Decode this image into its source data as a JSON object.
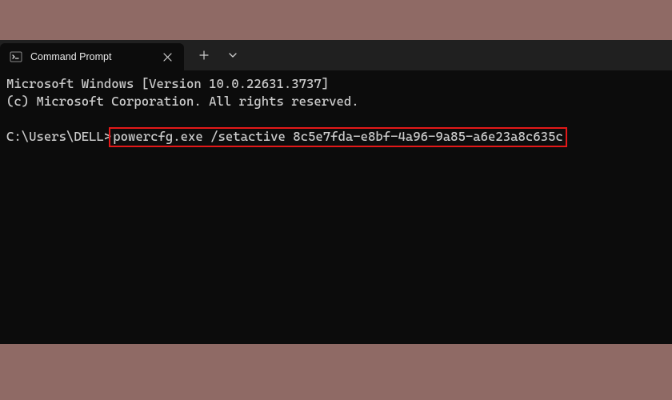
{
  "tab": {
    "title": "Command Prompt"
  },
  "terminal": {
    "line1": "Microsoft Windows [Version 10.0.22631.3737]",
    "line2": "(c) Microsoft Corporation. All rights reserved.",
    "prompt": "C:\\Users\\DELL>",
    "command": "powercfg.exe /setactive 8c5e7fda-e8bf-4a96-9a85-a6e23a8c635c"
  },
  "highlight_color": "#e41818"
}
